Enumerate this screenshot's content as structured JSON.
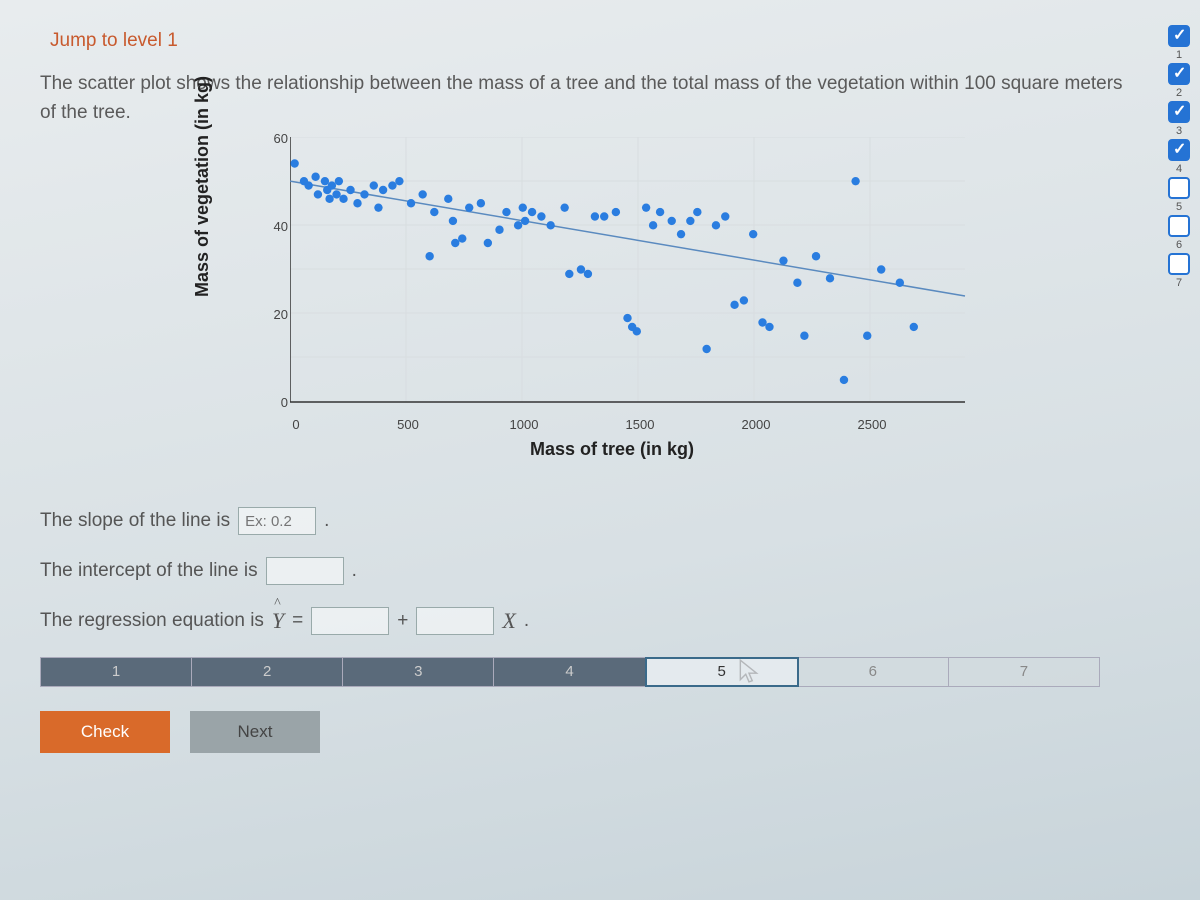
{
  "jump_link": "Jump to level 1",
  "prompt": "The scatter plot shows the relationship between the mass of a tree and the total mass of the vegetation within 100 square meters of the tree.",
  "chart_data": {
    "type": "scatter",
    "xlabel": "Mass of tree (in kg)",
    "ylabel": "Mass of vegetation (in kg)",
    "xlim": [
      0,
      2900
    ],
    "ylim": [
      0,
      60
    ],
    "xticks": [
      0,
      500,
      1000,
      1500,
      2000,
      2500
    ],
    "yticks": [
      0,
      20,
      40,
      60
    ],
    "trend_line": {
      "x1": 0,
      "y1": 50,
      "x2": 2900,
      "y2": 24
    },
    "points": [
      [
        20,
        54
      ],
      [
        60,
        50
      ],
      [
        80,
        49
      ],
      [
        110,
        51
      ],
      [
        120,
        47
      ],
      [
        150,
        50
      ],
      [
        160,
        48
      ],
      [
        170,
        46
      ],
      [
        180,
        49
      ],
      [
        200,
        47
      ],
      [
        210,
        50
      ],
      [
        230,
        46
      ],
      [
        260,
        48
      ],
      [
        290,
        45
      ],
      [
        320,
        47
      ],
      [
        360,
        49
      ],
      [
        380,
        44
      ],
      [
        400,
        48
      ],
      [
        440,
        49
      ],
      [
        470,
        50
      ],
      [
        520,
        45
      ],
      [
        570,
        47
      ],
      [
        600,
        33
      ],
      [
        620,
        43
      ],
      [
        680,
        46
      ],
      [
        700,
        41
      ],
      [
        710,
        36
      ],
      [
        740,
        37
      ],
      [
        770,
        44
      ],
      [
        820,
        45
      ],
      [
        850,
        36
      ],
      [
        900,
        39
      ],
      [
        930,
        43
      ],
      [
        980,
        40
      ],
      [
        1000,
        44
      ],
      [
        1010,
        41
      ],
      [
        1040,
        43
      ],
      [
        1080,
        42
      ],
      [
        1120,
        40
      ],
      [
        1180,
        44
      ],
      [
        1200,
        29
      ],
      [
        1250,
        30
      ],
      [
        1280,
        29
      ],
      [
        1310,
        42
      ],
      [
        1350,
        42
      ],
      [
        1400,
        43
      ],
      [
        1450,
        19
      ],
      [
        1470,
        17
      ],
      [
        1490,
        16
      ],
      [
        1530,
        44
      ],
      [
        1560,
        40
      ],
      [
        1590,
        43
      ],
      [
        1640,
        41
      ],
      [
        1680,
        38
      ],
      [
        1720,
        41
      ],
      [
        1750,
        43
      ],
      [
        1790,
        12
      ],
      [
        1830,
        40
      ],
      [
        1870,
        42
      ],
      [
        1910,
        22
      ],
      [
        1950,
        23
      ],
      [
        1990,
        38
      ],
      [
        2030,
        18
      ],
      [
        2060,
        17
      ],
      [
        2120,
        32
      ],
      [
        2180,
        27
      ],
      [
        2210,
        15
      ],
      [
        2260,
        33
      ],
      [
        2320,
        28
      ],
      [
        2380,
        5
      ],
      [
        2430,
        50
      ],
      [
        2480,
        15
      ],
      [
        2540,
        30
      ],
      [
        2620,
        27
      ],
      [
        2680,
        17
      ]
    ]
  },
  "questions": {
    "slope_label": "The slope of the line is",
    "slope_placeholder": "Ex: 0.2",
    "intercept_label": "The intercept of the line is",
    "equation_label": "The regression equation is",
    "y_hat": "Y",
    "equals": "=",
    "plus": "+",
    "x_var": "X"
  },
  "pager": {
    "steps": [
      "1",
      "2",
      "3",
      "4",
      "5",
      "6",
      "7"
    ],
    "current_index": 4,
    "done_count": 4
  },
  "buttons": {
    "check": "Check",
    "next": "Next"
  },
  "tracker": {
    "items": [
      {
        "n": "1",
        "state": "checked"
      },
      {
        "n": "2",
        "state": "checked"
      },
      {
        "n": "3",
        "state": "checked"
      },
      {
        "n": "4",
        "state": "checked"
      },
      {
        "n": "5",
        "state": "empty"
      },
      {
        "n": "6",
        "state": "empty"
      },
      {
        "n": "7",
        "state": "empty"
      }
    ]
  }
}
